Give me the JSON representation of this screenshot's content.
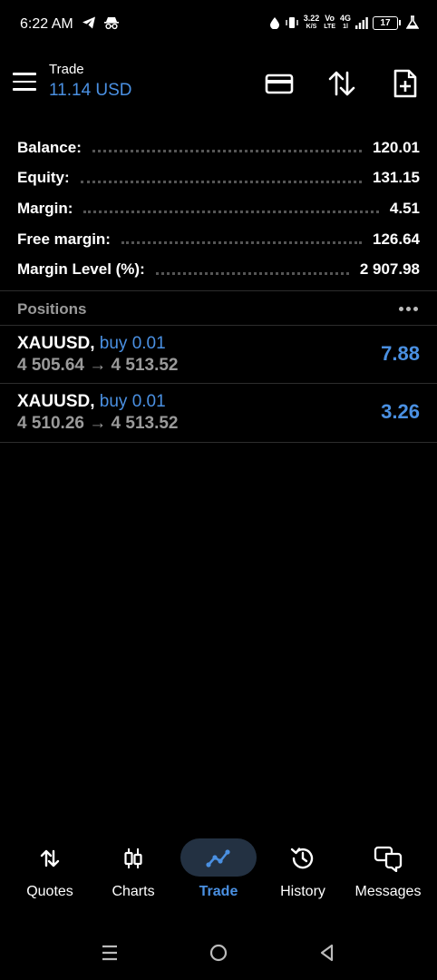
{
  "status_bar": {
    "time": "6:22 AM",
    "speed_value": "3.22",
    "speed_unit": "K/S",
    "volte_top": "Vo",
    "volte_bottom": "LTE",
    "network_top": "4G",
    "network_bottom": "1l",
    "battery": "17",
    "icons": [
      "telegram-icon",
      "incognito-icon",
      "drop-icon",
      "vibrate-icon",
      "signal-icon",
      "battery-icon",
      "flask-icon"
    ]
  },
  "header": {
    "title": "Trade",
    "subtitle": "11.14 USD",
    "actions": [
      "card-icon",
      "sort-icon",
      "add-document-icon"
    ]
  },
  "account": {
    "rows": [
      {
        "label": "Balance:",
        "value": "120.01"
      },
      {
        "label": "Equity:",
        "value": "131.15"
      },
      {
        "label": "Margin:",
        "value": "4.51"
      },
      {
        "label": "Free margin:",
        "value": "126.64"
      },
      {
        "label": "Margin Level (%):",
        "value": "2 907.98"
      }
    ]
  },
  "positions": {
    "title": "Positions",
    "items": [
      {
        "symbol": "XAUUSD,",
        "side": "buy 0.01",
        "open_price": "4 505.64",
        "arrow": "→",
        "current_price": "4 513.52",
        "profit": "7.88"
      },
      {
        "symbol": "XAUUSD,",
        "side": "buy 0.01",
        "open_price": "4 510.26",
        "arrow": "→",
        "current_price": "4 513.52",
        "profit": "3.26"
      }
    ]
  },
  "bottom_nav": {
    "items": [
      {
        "label": "Quotes",
        "icon": "quotes-icon",
        "active": false
      },
      {
        "label": "Charts",
        "icon": "charts-icon",
        "active": false
      },
      {
        "label": "Trade",
        "icon": "trade-icon",
        "active": true
      },
      {
        "label": "History",
        "icon": "history-icon",
        "active": false
      },
      {
        "label": "Messages",
        "icon": "messages-icon",
        "active": false
      }
    ]
  },
  "colors": {
    "accent": "#4a90e2",
    "background": "#000000",
    "muted": "#9a9a9a",
    "active_pill": "#233142"
  }
}
